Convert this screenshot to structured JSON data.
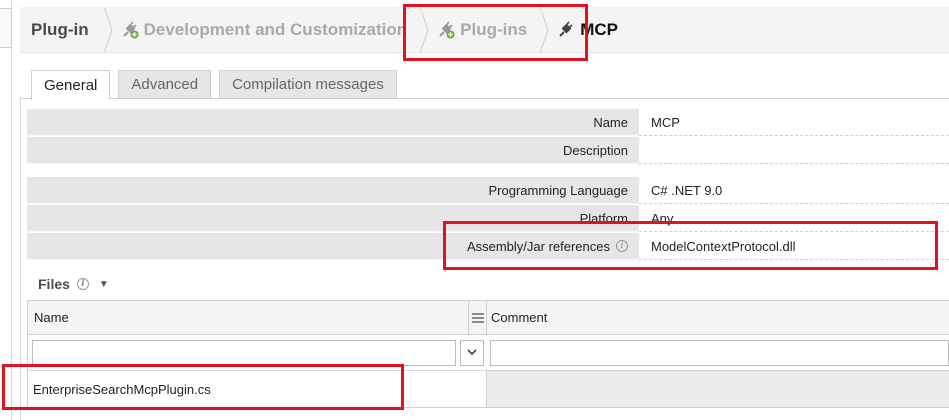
{
  "breadcrumb": {
    "root": "Plug-in",
    "items": [
      {
        "label": "Development and Customization",
        "icon": "plug-add-icon"
      },
      {
        "label": "Plug-ins",
        "icon": "plug-add-icon"
      },
      {
        "label": "MCP",
        "icon": "plug-icon"
      }
    ]
  },
  "tabs": [
    {
      "label": "General",
      "active": true
    },
    {
      "label": "Advanced",
      "active": false
    },
    {
      "label": "Compilation messages",
      "active": false
    }
  ],
  "properties": {
    "name": {
      "label": "Name",
      "value": "MCP"
    },
    "description": {
      "label": "Description",
      "value": ""
    },
    "language": {
      "label": "Programming Language",
      "value": "C# .NET 9.0"
    },
    "platform": {
      "label": "Platform",
      "value": "Any"
    },
    "assembly": {
      "label": "Assembly/Jar references",
      "value": "ModelContextProtocol.dll",
      "info_icon": "info-icon"
    }
  },
  "files": {
    "title": "Files",
    "columns": {
      "name": "Name",
      "comment": "Comment"
    },
    "rows": [
      {
        "name": "EnterpriseSearchMcpPlugin.cs",
        "comment": ""
      }
    ]
  },
  "colors": {
    "highlight": "#e0141e",
    "label_bg": "#e6e6e6",
    "plugin_green": "#5cb531"
  }
}
